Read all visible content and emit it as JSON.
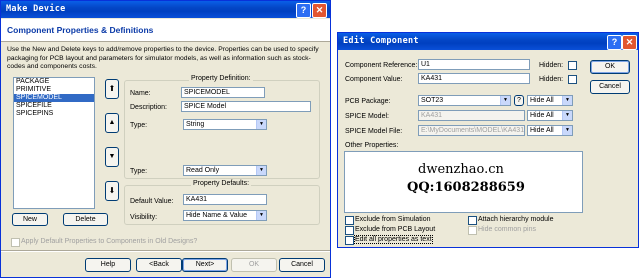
{
  "make_device": {
    "title": "Make Device",
    "header_title": "Component Properties & Definitions",
    "description": "Use the New and Delete keys to add/remove properties to the device. Properties can be used to specify packaging for PCB layout and parameters for simulator models, as well as information such as stock-codes and components costs.",
    "properties": [
      "PACKAGE",
      "PRIMITIVE",
      "SPICEMODEL",
      "SPICEFILE",
      "SPICEPINS"
    ],
    "selected_property": "SPICEMODEL",
    "new_label": "New",
    "delete_label": "Delete",
    "definition_title": "Property Definition:",
    "name_label": "Name:",
    "name_value": "SPICEMODEL",
    "description_label": "Description:",
    "description_value": "SPICE Model",
    "type_label": "Type:",
    "type_value": "String",
    "type2_label": "Type:",
    "type2_value": "Read Only",
    "defaults_title": "Property Defaults:",
    "default_value_label": "Default Value:",
    "default_value": "KA431",
    "visibility_label": "Visibility:",
    "visibility_value": "Hide Name & Value",
    "apply_default_label": "Apply Default Properties to Components in Old Designs?",
    "help_label": "Help",
    "back_label": "<Back",
    "next_label": "Next>",
    "ok_label": "OK",
    "cancel_label": "Cancel"
  },
  "edit_component": {
    "title": "Edit Component",
    "reference_label": "Component Reference:",
    "reference_value": "U1",
    "value_label": "Component Value:",
    "value_value": "KA431",
    "hidden_label": "Hidden:",
    "hidden2_label": "Hidden:",
    "ok_label": "OK",
    "cancel_label": "Cancel",
    "package_label": "PCB Package:",
    "package_value": "SOT23",
    "package_q": "?",
    "package_vis": "Hide All",
    "model_label": "SPICE Model:",
    "model_value": "KA431",
    "model_vis": "Hide All",
    "model_file_label": "SPICE Model File:",
    "model_file_value": "E:\\MyDocuments\\MODEL\\KA431.L",
    "model_file_vis": "Hide All",
    "other_label": "Other Properties:",
    "watermark_site": "dwenzhao.cn",
    "watermark_qq": "QQ:1608288659",
    "exclude_sim": "Exclude from Simulation",
    "exclude_pcb": "Exclude from PCB Layout",
    "edit_all": "Edit all properties as text",
    "attach_hier": "Attach hierarchy module",
    "hide_pins": "Hide common pins"
  }
}
